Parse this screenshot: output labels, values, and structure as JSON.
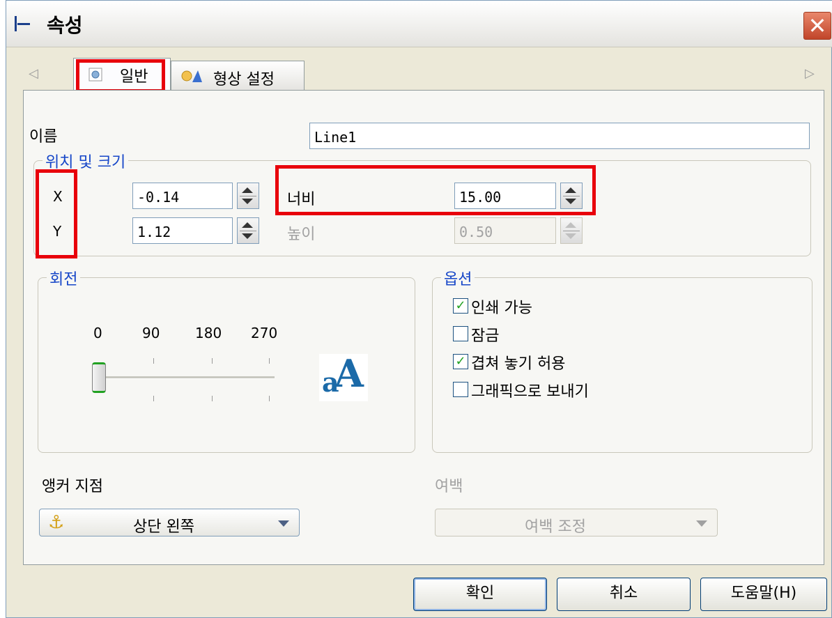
{
  "window": {
    "title": "속성",
    "close_glyph": "✕"
  },
  "tabs": [
    {
      "label": "일반",
      "icon": "gear-doc-icon"
    },
    {
      "label": "형상 설정",
      "icon": "shapes-icon"
    }
  ],
  "nav": {
    "left_arrow": "◁",
    "right_arrow": "▷"
  },
  "name_field": {
    "label": "이름",
    "value": "Line1"
  },
  "position_group": {
    "legend": "위치 및 크기",
    "x": {
      "label": "X",
      "value": "-0.14"
    },
    "y": {
      "label": "Y",
      "value": "1.12"
    },
    "width": {
      "label": "너비",
      "value": "15.00"
    },
    "height": {
      "label": "높이",
      "value": "0.50",
      "disabled": true
    }
  },
  "rotation_group": {
    "legend": "회전",
    "ticks": [
      "0",
      "90",
      "180",
      "270"
    ],
    "value": 0,
    "preview_glyph_small": "a",
    "preview_glyph_large": "A"
  },
  "options_group": {
    "legend": "옵션",
    "items": [
      {
        "label": "인쇄 가능",
        "checked": true
      },
      {
        "label": "잠금",
        "checked": false
      },
      {
        "label": "겹쳐 놓기 허용",
        "checked": true
      },
      {
        "label": "그래픽으로 보내기",
        "checked": false
      }
    ]
  },
  "anchor": {
    "label": "앵커 지점",
    "value": "상단 왼쪽",
    "icon_glyph": "⚓"
  },
  "margin": {
    "label": "여백",
    "value": "여백 조정",
    "disabled": true
  },
  "buttons": {
    "ok": "확인",
    "cancel": "취소",
    "help": "도움말(H)"
  },
  "colors": {
    "highlight": "#e8000b",
    "legend_blue": "#1646c8",
    "check_green": "#21a121"
  }
}
